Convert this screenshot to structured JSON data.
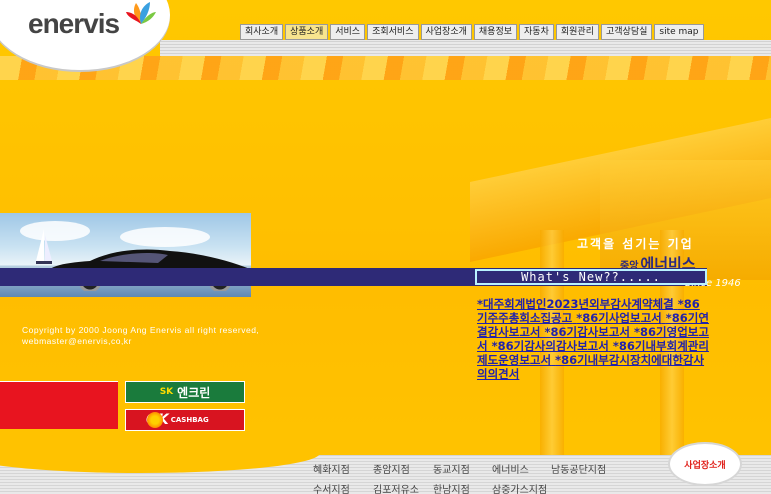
{
  "brand": {
    "logo_text": "enervis"
  },
  "nav": {
    "items": [
      "회사소개",
      "상품소개",
      "서비스",
      "조회서비스",
      "사업장소개",
      "채용정보",
      "자동차",
      "회원관리",
      "고객상담실",
      "site map"
    ],
    "active_index": 1
  },
  "promo": {
    "slogan": "고객을 섬기는 기업",
    "company_prefix": "중앙",
    "company_name": "에너비스",
    "since": "Since 1946"
  },
  "whats_new": {
    "title": "What's New??....."
  },
  "news_items": [
    "*대주회계법인2023년외부감사계약체결",
    "*86기주주총회소집공고",
    "*86기사업보고서",
    "*86기연결감사보고서",
    "*86기감사보고서",
    "*86기영업보고서",
    "*86기감사의감사보고서",
    "*86기내부회계관리제도운영보고서",
    "*86기내부감시장치에대한감사의의견서"
  ],
  "copyright": {
    "line1": "Copyright by 2000 Joong Ang Enervis all right reserved,",
    "line2": "webmaster@enervis,co,kr"
  },
  "banners": {
    "ensclean_sk": "SK",
    "ensclean_name": "엔크린",
    "okcash_ok": "OK",
    "okcash_sub": "CASHBAG"
  },
  "stations": {
    "row1": [
      "혜화지점",
      "종암지점",
      "동교지점",
      "에너비스",
      "남동공단지점"
    ],
    "row2": [
      "수서지점",
      "김포저유소",
      "한남지점",
      "삼중가스지점"
    ]
  },
  "biz_button": "사업장소개",
  "colors": {
    "background": "#ffc200",
    "navy": "#2e2a77",
    "link": "#2222aa",
    "accent_red": "#e8141f"
  }
}
